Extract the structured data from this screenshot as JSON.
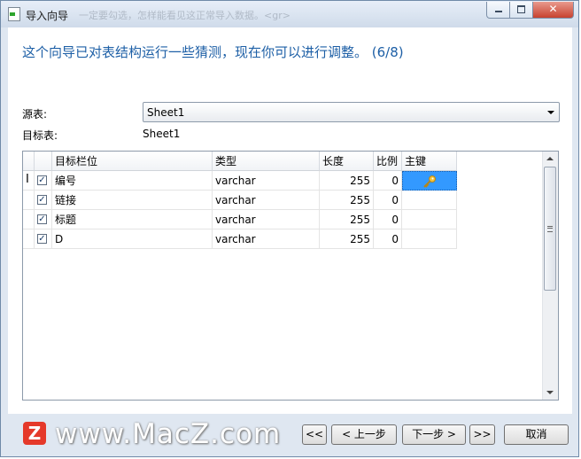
{
  "window": {
    "title": "导入向导",
    "ghost_text": "一定要勾选，怎样能看见这正常导入数据。<gr>",
    "close_symbol": "✕"
  },
  "step": {
    "headline": "这个向导已对表结构运行一些猜测，现在你可以进行调整。 (6/8)"
  },
  "source": {
    "label": "源表:",
    "value": "Sheet1"
  },
  "target": {
    "label": "目标表:",
    "value": "Sheet1"
  },
  "grid": {
    "columns": {
      "name": "目标栏位",
      "type": "类型",
      "length": "长度",
      "scale": "比例",
      "pk": "主键"
    },
    "rows": [
      {
        "checked": "✓",
        "name": "编号",
        "type": "varchar",
        "length": "255",
        "scale": "0",
        "pk": "key-icon"
      },
      {
        "checked": "✓",
        "name": "链接",
        "type": "varchar",
        "length": "255",
        "scale": "0",
        "pk": ""
      },
      {
        "checked": "✓",
        "name": "标题",
        "type": "varchar",
        "length": "255",
        "scale": "0",
        "pk": ""
      },
      {
        "checked": "✓",
        "name": "D",
        "type": "varchar",
        "length": "255",
        "scale": "0",
        "pk": ""
      }
    ]
  },
  "footer": {
    "first": "<<",
    "prev": "< 上一步",
    "next": "下一步 >",
    "last": ">>",
    "cancel": "取消"
  },
  "watermark": {
    "text": "www.MacZ.com",
    "logo": "Z"
  }
}
